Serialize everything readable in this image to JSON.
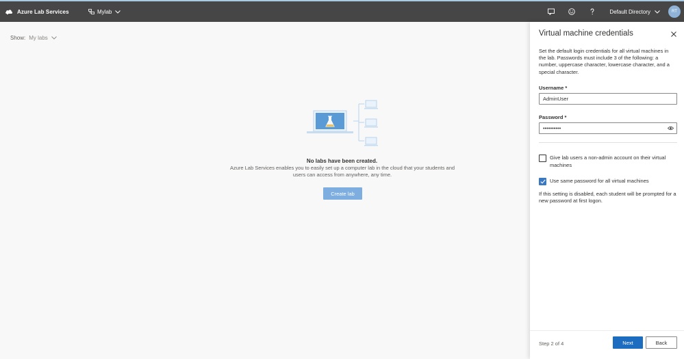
{
  "topbar": {
    "app_title": "Azure Lab Services",
    "lab_name": "Mylab",
    "directory": "Default Directory",
    "avatar_initials": "RT",
    "icons": [
      "cloud-logo-icon",
      "lab-icon",
      "feedback-icon",
      "smiley-icon",
      "help-icon",
      "chevron-down-icon"
    ]
  },
  "main": {
    "show_label": "Show:",
    "show_value": "My labs",
    "empty_title": "No labs have been created.",
    "empty_desc": "Azure Lab Services enables you to easily set up a computer lab in the cloud that your students and users can access from anywhere, any time.",
    "create_button": "Create lab"
  },
  "panel": {
    "title": "Virtual machine credentials",
    "description": "Set the default login credentials for all virtual machines in the lab. Passwords must include 3 of the following: a number, uppercase character, lowercase character, and a special character.",
    "username_label": "Username",
    "username_value": "AdminUser",
    "password_label": "Password",
    "password_value": "••••••••••",
    "required_marker": "*",
    "checkbox_nonadmin": {
      "label": "Give lab users a non-admin account on their virtual machines",
      "checked": false
    },
    "checkbox_samepwd": {
      "label": "Use same password for all virtual machines",
      "checked": true
    },
    "note": "If this setting is disabled, each student will be prompted for a new password at first logon.",
    "step": "Step 2 of 4",
    "next_button": "Next",
    "back_button": "Back"
  },
  "colors": {
    "topbar_bg": "#464646",
    "primary": "#1c6cc0",
    "primary_disabled": "#7eaee0",
    "avatar_bg": "#8fb3d6"
  }
}
